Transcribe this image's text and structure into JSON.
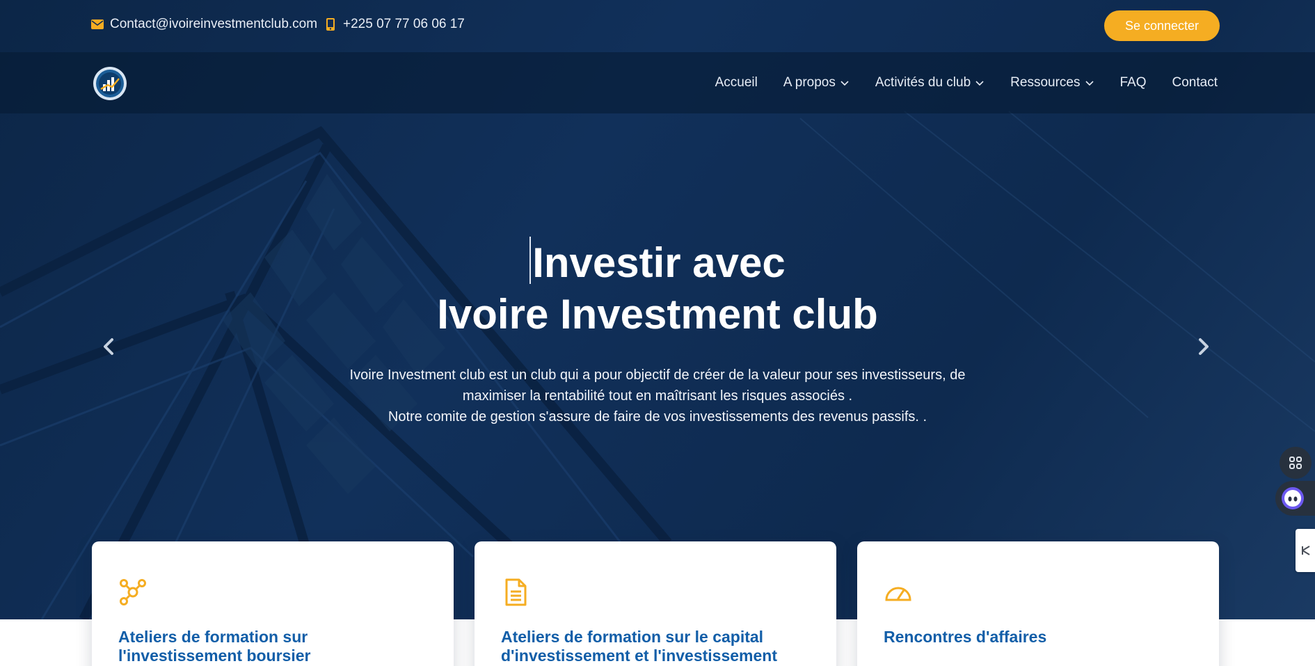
{
  "topbar": {
    "email": "Contact@ivoireinvestmentclub.com",
    "phone": "+225 07 77 06 06 17",
    "login_label": "Se connecter"
  },
  "nav": {
    "items": [
      {
        "label": "Accueil",
        "dropdown": false
      },
      {
        "label": "A propos",
        "dropdown": true
      },
      {
        "label": "Activités du club",
        "dropdown": true
      },
      {
        "label": "Ressources",
        "dropdown": true
      },
      {
        "label": "FAQ",
        "dropdown": false
      },
      {
        "label": "Contact",
        "dropdown": false
      }
    ]
  },
  "hero": {
    "title_line1": "Investir avec",
    "title_line2": "Ivoire Investment club",
    "text_line1": "Ivoire Investment club est un club qui a pour objectif de créer de la valeur pour ses investisseurs, de",
    "text_line2": "maximiser la rentabilité tout en maîtrisant les risques associés .",
    "text_line3": "Notre comite de gestion s'assure de faire de vos investissements des revenus passifs. ."
  },
  "cards": [
    {
      "title": "Ateliers de formation sur l'investissement boursier",
      "icon": "network-nodes-icon"
    },
    {
      "title": "Ateliers de formation sur le capital d'investissement et l'investissement",
      "icon": "document-icon"
    },
    {
      "title": "Rencontres d'affaires",
      "icon": "speedometer-icon"
    }
  ],
  "colors": {
    "hero_bg": "#0f2c52",
    "accent": "#f5ad22",
    "card_title": "#125ea8",
    "nav_text": "#e7edf6"
  }
}
